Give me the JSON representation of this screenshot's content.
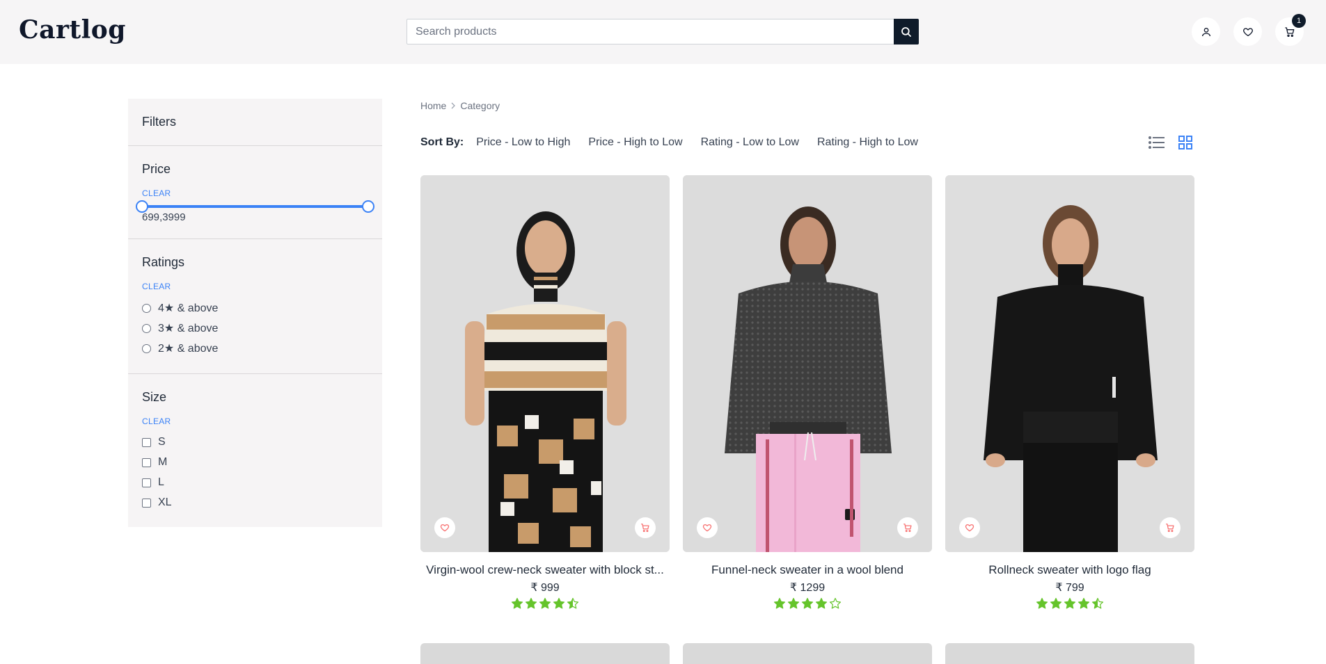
{
  "header": {
    "logo": "Cartlog",
    "search_placeholder": "Search products",
    "cart_count": "1"
  },
  "filters": {
    "title": "Filters",
    "price": {
      "title": "Price",
      "clear": "CLEAR",
      "range_text": "699,3999",
      "min": 699,
      "max": 3999
    },
    "ratings": {
      "title": "Ratings",
      "clear": "CLEAR",
      "options": [
        "4★ & above",
        "3★ & above",
        "2★ & above"
      ]
    },
    "size": {
      "title": "Size",
      "clear": "CLEAR",
      "options": [
        "S",
        "M",
        "L",
        "XL"
      ]
    }
  },
  "breadcrumb": {
    "home": "Home",
    "current": "Category"
  },
  "sort": {
    "label": "Sort By:",
    "options": [
      "Price - Low to High",
      "Price - High to Low",
      "Rating - Low to Low",
      "Rating - High to Low"
    ]
  },
  "colors": {
    "accent": "#3b82f6",
    "star": "#65c42b",
    "dark": "#0f1b2a",
    "heart": "#f87171"
  },
  "products": [
    {
      "name": "Virgin-wool crew-neck sweater with block st...",
      "price": "₹ 999",
      "rating": 4.5
    },
    {
      "name": "Funnel-neck sweater in a wool blend",
      "price": "₹ 1299",
      "rating": 4
    },
    {
      "name": "Rollneck sweater with logo flag",
      "price": "₹ 799",
      "rating": 4.5
    }
  ]
}
